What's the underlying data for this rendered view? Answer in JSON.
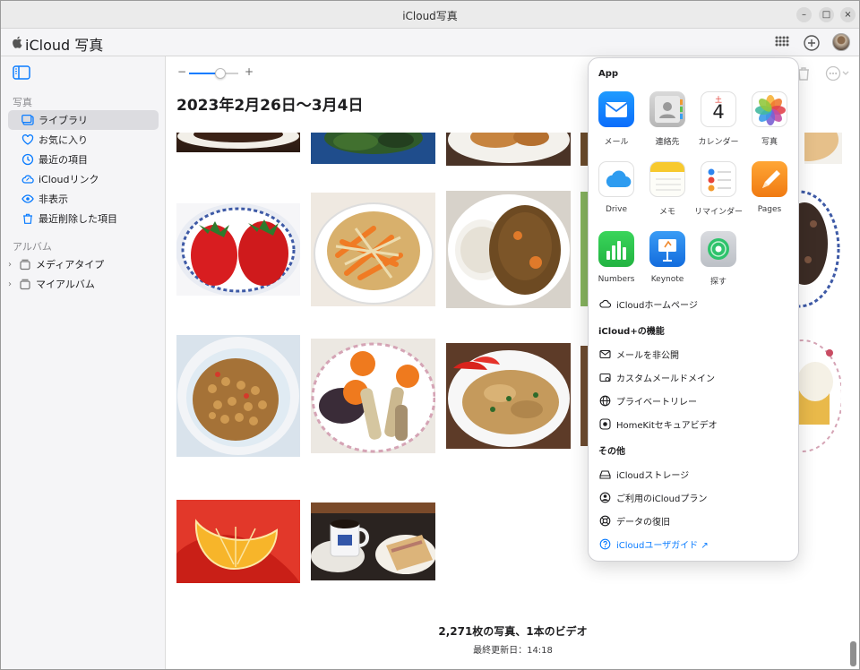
{
  "window": {
    "title": "iCloud写真",
    "minimize": "–",
    "maximize": "□",
    "close": "×"
  },
  "header": {
    "apple_glyph": "",
    "app_name": "iCloud 写真"
  },
  "sidebar": {
    "photos_header": "写真",
    "items": [
      {
        "label": "ライブラリ",
        "icon": "library-icon"
      },
      {
        "label": "お気に入り",
        "icon": "heart-icon"
      },
      {
        "label": "最近の項目",
        "icon": "clock-icon"
      },
      {
        "label": "iCloudリンク",
        "icon": "cloud-link-icon"
      },
      {
        "label": "非表示",
        "icon": "eye-icon"
      },
      {
        "label": "最近削除した項目",
        "icon": "trash-icon"
      }
    ],
    "albums_header": "アルバム",
    "albums": [
      {
        "label": "メディアタイプ"
      },
      {
        "label": "マイアルバム"
      }
    ]
  },
  "main": {
    "zoom": {
      "minus": "−",
      "plus": "+",
      "level": 0.55
    },
    "date_range": "2023年2月26日〜3月4日",
    "footer_count": "2,271枚の写真、1本のビデオ",
    "footer_updated": "最終更新日：14:18"
  },
  "popover": {
    "apps_header": "App",
    "apps": [
      {
        "label": "メール",
        "icon": "mail-icon"
      },
      {
        "label": "連絡先",
        "icon": "contacts-icon"
      },
      {
        "label": "カレンダー",
        "icon": "calendar-icon",
        "cal_day": "土",
        "cal_date": "4"
      },
      {
        "label": "写真",
        "icon": "photos-icon"
      },
      {
        "label": "Drive",
        "icon": "drive-icon"
      },
      {
        "label": "メモ",
        "icon": "notes-icon"
      },
      {
        "label": "リマインダー",
        "icon": "reminders-icon"
      },
      {
        "label": "Pages",
        "icon": "pages-icon"
      },
      {
        "label": "Numbers",
        "icon": "numbers-icon"
      },
      {
        "label": "Keynote",
        "icon": "keynote-icon"
      },
      {
        "label": "探す",
        "icon": "findmy-icon"
      }
    ],
    "homepage": "iCloudホームページ",
    "plus_header": "iCloud+の機能",
    "plus_items": [
      "メールを非公開",
      "カスタムメールドメイン",
      "プライベートリレー",
      "HomeKitセキュアビデオ"
    ],
    "other_header": "その他",
    "other_items": [
      "iCloudストレージ",
      "ご利用のiCloudプラン",
      "データの復旧"
    ],
    "guide": "iCloudユーザガイド ↗"
  },
  "colors": {
    "accent": "#0a7cff",
    "sidebar_bg": "#f5f5f7",
    "selected_bg": "#dcdce0"
  }
}
